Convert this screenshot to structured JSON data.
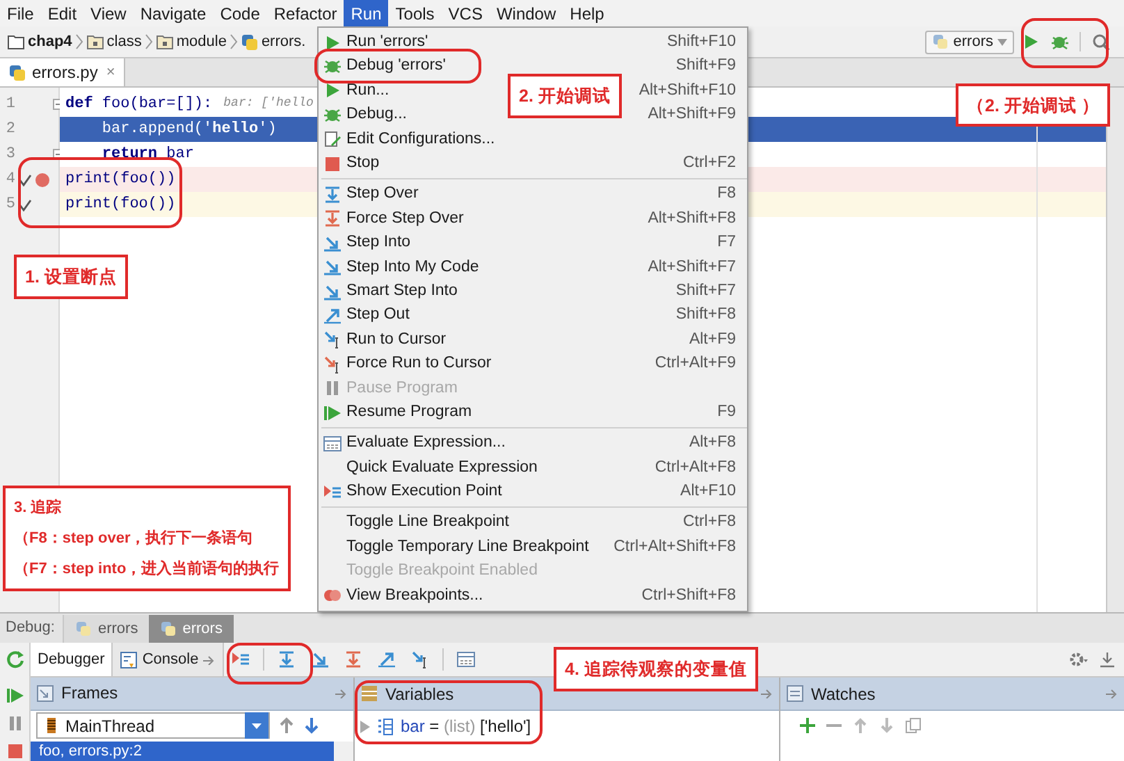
{
  "menu_bar": [
    {
      "label": "File",
      "selected": false
    },
    {
      "label": "Edit",
      "selected": false
    },
    {
      "label": "View",
      "selected": false
    },
    {
      "label": "Navigate",
      "selected": false
    },
    {
      "label": "Code",
      "selected": false
    },
    {
      "label": "Refactor",
      "selected": false
    },
    {
      "label": "Run",
      "selected": true
    },
    {
      "label": "Tools",
      "selected": false
    },
    {
      "label": "VCS",
      "selected": false
    },
    {
      "label": "Window",
      "selected": false
    },
    {
      "label": "Help",
      "selected": false
    }
  ],
  "breadcrumbs": [
    {
      "label": "chap4",
      "kind": "project"
    },
    {
      "label": "class",
      "kind": "package"
    },
    {
      "label": "module",
      "kind": "package"
    },
    {
      "label": "errors.",
      "kind": "file"
    }
  ],
  "run_config": {
    "label": "errors"
  },
  "editor_tabs": [
    {
      "label": "errors.py",
      "close": "×",
      "selected": true
    }
  ],
  "editor": {
    "lines": [
      {
        "number": "1",
        "code": "**def** foo(bar=[]):",
        "hint": "bar: ['hello",
        "kind": "plain",
        "foldable": true,
        "breakpoint": false,
        "checked": false
      },
      {
        "number": "2",
        "code": "    bar.append('**hello**')",
        "kind": "current",
        "foldable": false,
        "breakpoint": false,
        "checked": false
      },
      {
        "number": "3",
        "code": "    **return** bar",
        "kind": "plain",
        "foldable": true,
        "breakpoint": false,
        "checked": false
      },
      {
        "number": "4",
        "code": "print(foo())",
        "kind": "breakpoint",
        "foldable": false,
        "breakpoint": true,
        "checked": true
      },
      {
        "number": "5",
        "code": "print(foo())",
        "kind": "caret",
        "foldable": false,
        "breakpoint": false,
        "checked": true
      }
    ]
  },
  "run_menu": {
    "groups": [
      [
        {
          "label": "Run 'errors'",
          "shortcut": "Shift+F10",
          "kind": "run",
          "disabled": false
        },
        {
          "label": "Debug 'errors'",
          "shortcut": "Shift+F9",
          "kind": "debug",
          "disabled": false
        },
        {
          "label": "Run...",
          "shortcut": "Alt+Shift+F10",
          "kind": "run",
          "disabled": false
        },
        {
          "label": "Debug...",
          "shortcut": "Alt+Shift+F9",
          "kind": "debug",
          "disabled": false
        },
        {
          "label": "Edit Configurations...",
          "kind": "edit",
          "disabled": false
        },
        {
          "label": "Stop",
          "shortcut": "Ctrl+F2",
          "kind": "stop",
          "disabled": false
        }
      ],
      [
        {
          "label": "Step Over",
          "shortcut": "F8",
          "kind": "step-over",
          "disabled": false
        },
        {
          "label": "Force Step Over",
          "shortcut": "Alt+Shift+F8",
          "kind": "force-step",
          "disabled": false
        },
        {
          "label": "Step Into",
          "shortcut": "F7",
          "kind": "step-into",
          "disabled": false
        },
        {
          "label": "Step Into My Code",
          "shortcut": "Alt+Shift+F7",
          "kind": "step-into",
          "disabled": false
        },
        {
          "label": "Smart Step Into",
          "shortcut": "Shift+F7",
          "kind": "step-into",
          "disabled": false
        },
        {
          "label": "Step Out",
          "shortcut": "Shift+F8",
          "kind": "step-out",
          "disabled": false
        },
        {
          "label": "Run to Cursor",
          "shortcut": "Alt+F9",
          "kind": "cursor",
          "disabled": false
        },
        {
          "label": "Force Run to Cursor",
          "shortcut": "Ctrl+Alt+F9",
          "kind": "force-cursor",
          "disabled": false
        },
        {
          "label": "Pause Program",
          "kind": "pause",
          "disabled": true
        },
        {
          "label": "Resume Program",
          "shortcut": "F9",
          "kind": "resume",
          "disabled": false
        }
      ],
      [
        {
          "label": "Evaluate Expression...",
          "shortcut": "Alt+F8",
          "kind": "evaluate",
          "disabled": false
        },
        {
          "label": "Quick Evaluate Expression",
          "shortcut": "Ctrl+Alt+F8",
          "kind": "plain",
          "disabled": false
        },
        {
          "label": "Show Execution Point",
          "shortcut": "Alt+F10",
          "kind": "execution",
          "disabled": false
        }
      ],
      [
        {
          "label": "Toggle Line Breakpoint",
          "shortcut": "Ctrl+F8",
          "kind": "plain",
          "disabled": false
        },
        {
          "label": "Toggle Temporary Line Breakpoint",
          "shortcut": "Ctrl+Alt+Shift+F8",
          "kind": "plain",
          "disabled": false
        },
        {
          "label": "Toggle Breakpoint Enabled",
          "kind": "plain",
          "disabled": true
        },
        {
          "label": "View Breakpoints...",
          "shortcut": "Ctrl+Shift+F8",
          "kind": "breakpoints",
          "disabled": false
        }
      ]
    ]
  },
  "debug": {
    "label": "Debug:",
    "sessions": [
      {
        "label": "errors",
        "selected": false
      },
      {
        "label": "errors",
        "selected": true
      }
    ],
    "tabs": [
      {
        "label": "Debugger",
        "selected": true
      },
      {
        "label": "Console",
        "selected": false
      }
    ],
    "frames": {
      "title": "Frames",
      "thread": "MainThread",
      "rows": [
        {
          "label": "foo, errors.py:2",
          "selected": true
        }
      ]
    },
    "variables": {
      "title": "Variables",
      "rows": [
        {
          "name": "bar",
          "equals": "=",
          "type": "(list)",
          "value": "['hello']"
        }
      ]
    },
    "watches": {
      "title": "Watches"
    }
  },
  "annotations": [
    {
      "lines": [
        "1. 设置断点"
      ]
    },
    {
      "lines": [
        "2. 开始调试"
      ]
    },
    {
      "lines": [
        "（2. 开始调试 ）"
      ]
    },
    {
      "lines": [
        "3. 追踪",
        "（F8：step over，执行下一条语句",
        "（F7：step into，进入当前语句的执行"
      ]
    },
    {
      "lines": [
        "4. 追踪待观察的变量值"
      ]
    }
  ]
}
